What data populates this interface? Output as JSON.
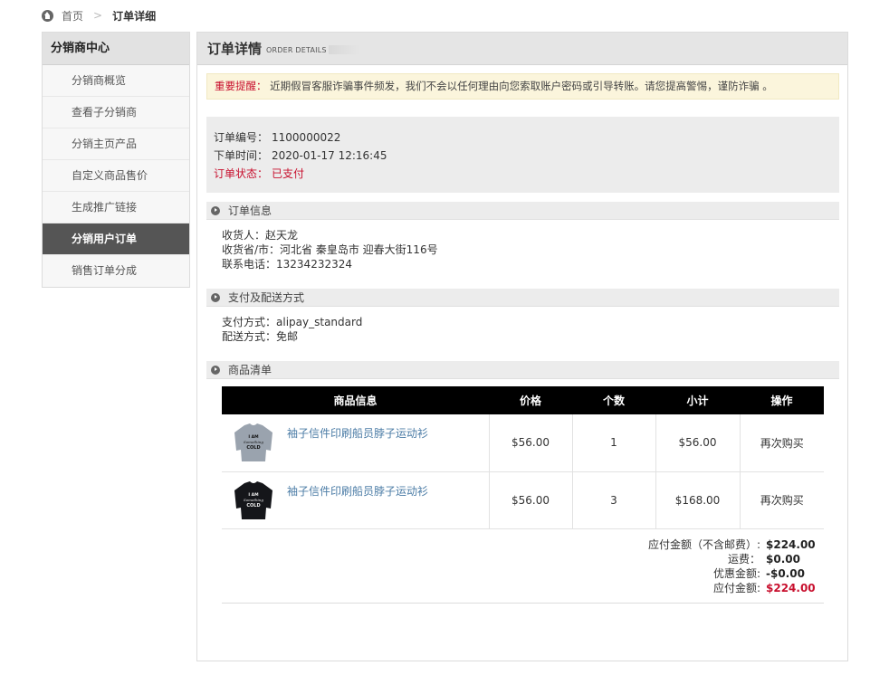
{
  "breadcrumb": {
    "home": "首页",
    "separator": ">",
    "current": "订单详细"
  },
  "sidebar": {
    "title": "分销商中心",
    "items": [
      {
        "label": "分销商概览"
      },
      {
        "label": "查看子分销商"
      },
      {
        "label": "分销主页产品"
      },
      {
        "label": "自定义商品售价"
      },
      {
        "label": "生成推广链接"
      },
      {
        "label": "分销用户订单",
        "active": true
      },
      {
        "label": "销售订单分成"
      }
    ]
  },
  "main": {
    "title": "订单详情",
    "subtitle": "ORDER DETAILS"
  },
  "notice": {
    "label": "重要提醒：",
    "text": "近期假冒客服诈骗事件频发，我们不会以任何理由向您索取账户密码或引导转账。请您提高警惕，谨防诈骗 。"
  },
  "order": {
    "number_label": "订单编号：",
    "number": "1100000022",
    "time_label": "下单时间：",
    "time": "2020-01-17 12:16:45",
    "status_label": "订单状态：",
    "status": "已支付"
  },
  "sections": {
    "order_info": "订单信息",
    "payment_shipping": "支付及配送方式",
    "product_list": "商品清单"
  },
  "consignee": {
    "name_label": "收货人：",
    "name": "赵天龙",
    "region_label": "收货省/市：",
    "region": "河北省 秦皇岛市 迎春大街116号",
    "phone_label": "联系电话：",
    "phone": "13234232324"
  },
  "payment": {
    "method_label": "支付方式：",
    "method": "alipay_standard",
    "shipping_label": "配送方式：",
    "shipping": "免邮"
  },
  "table": {
    "headers": [
      "商品信息",
      "价格",
      "个数",
      "小计",
      "操作"
    ],
    "rows": [
      {
        "name": "袖子信件印刷船员脖子运动衫",
        "price": "$56.00",
        "qty": "1",
        "subtotal": "$56.00",
        "action": "再次购买",
        "thumb_color": "#9aa3ae"
      },
      {
        "name": "袖子信件印刷船员脖子运动衫",
        "price": "$56.00",
        "qty": "3",
        "subtotal": "$168.00",
        "action": "再次购买",
        "thumb_color": "#15161a"
      }
    ]
  },
  "totals": {
    "payable_excl_label": "应付金额（不含邮费）:",
    "payable_excl": "$224.00",
    "shipping_label": "运费：",
    "shipping": "$0.00",
    "discount_label": "优惠金额:",
    "discount": "-$0.00",
    "payable_label": "应付金额:",
    "payable": "$224.00"
  },
  "colors": {
    "accent_red": "#c8102e",
    "link_blue": "#4b7ca6",
    "table_header": "#000000"
  }
}
